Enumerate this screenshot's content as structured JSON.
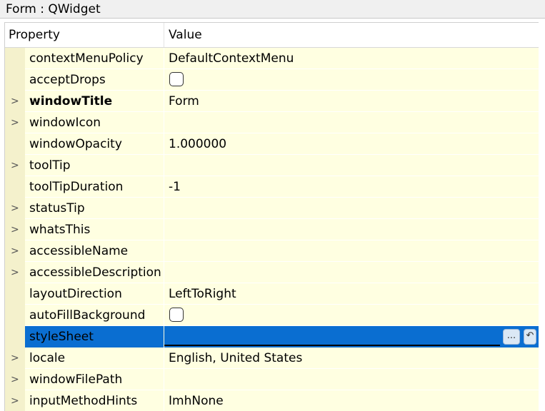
{
  "window": {
    "title": "Form : QWidget"
  },
  "header": {
    "property": "Property",
    "value": "Value"
  },
  "rows": [
    {
      "name": "contextMenuPolicy",
      "value": "DefaultContextMenu",
      "expandable": false
    },
    {
      "name": "acceptDrops",
      "value": "",
      "checkbox": true,
      "checked": false,
      "expandable": false
    },
    {
      "name": "windowTitle",
      "value": "Form",
      "expandable": true,
      "bold": true
    },
    {
      "name": "windowIcon",
      "value": "",
      "expandable": true
    },
    {
      "name": "windowOpacity",
      "value": "1.000000",
      "expandable": false
    },
    {
      "name": "toolTip",
      "value": "",
      "expandable": true
    },
    {
      "name": "toolTipDuration",
      "value": "-1",
      "expandable": false
    },
    {
      "name": "statusTip",
      "value": "",
      "expandable": true
    },
    {
      "name": "whatsThis",
      "value": "",
      "expandable": true
    },
    {
      "name": "accessibleName",
      "value": "",
      "expandable": true
    },
    {
      "name": "accessibleDescription",
      "value": "",
      "expandable": true
    },
    {
      "name": "layoutDirection",
      "value": "LeftToRight",
      "expandable": false
    },
    {
      "name": "autoFillBackground",
      "value": "",
      "checkbox": true,
      "checked": false,
      "expandable": false
    },
    {
      "name": "styleSheet",
      "value": "",
      "expandable": false,
      "selected": true,
      "more_label": "...",
      "reset_icon": "reset-arrow-icon"
    },
    {
      "name": "locale",
      "value": "English, United States",
      "expandable": true
    },
    {
      "name": "windowFilePath",
      "value": "",
      "expandable": true
    },
    {
      "name": "inputMethodHints",
      "value": "ImhNone",
      "expandable": true
    }
  ],
  "icons": {
    "expand": "chevron-right-icon"
  },
  "colors": {
    "row_bg": "#ffffe1",
    "selection": "#0a6ed1"
  }
}
